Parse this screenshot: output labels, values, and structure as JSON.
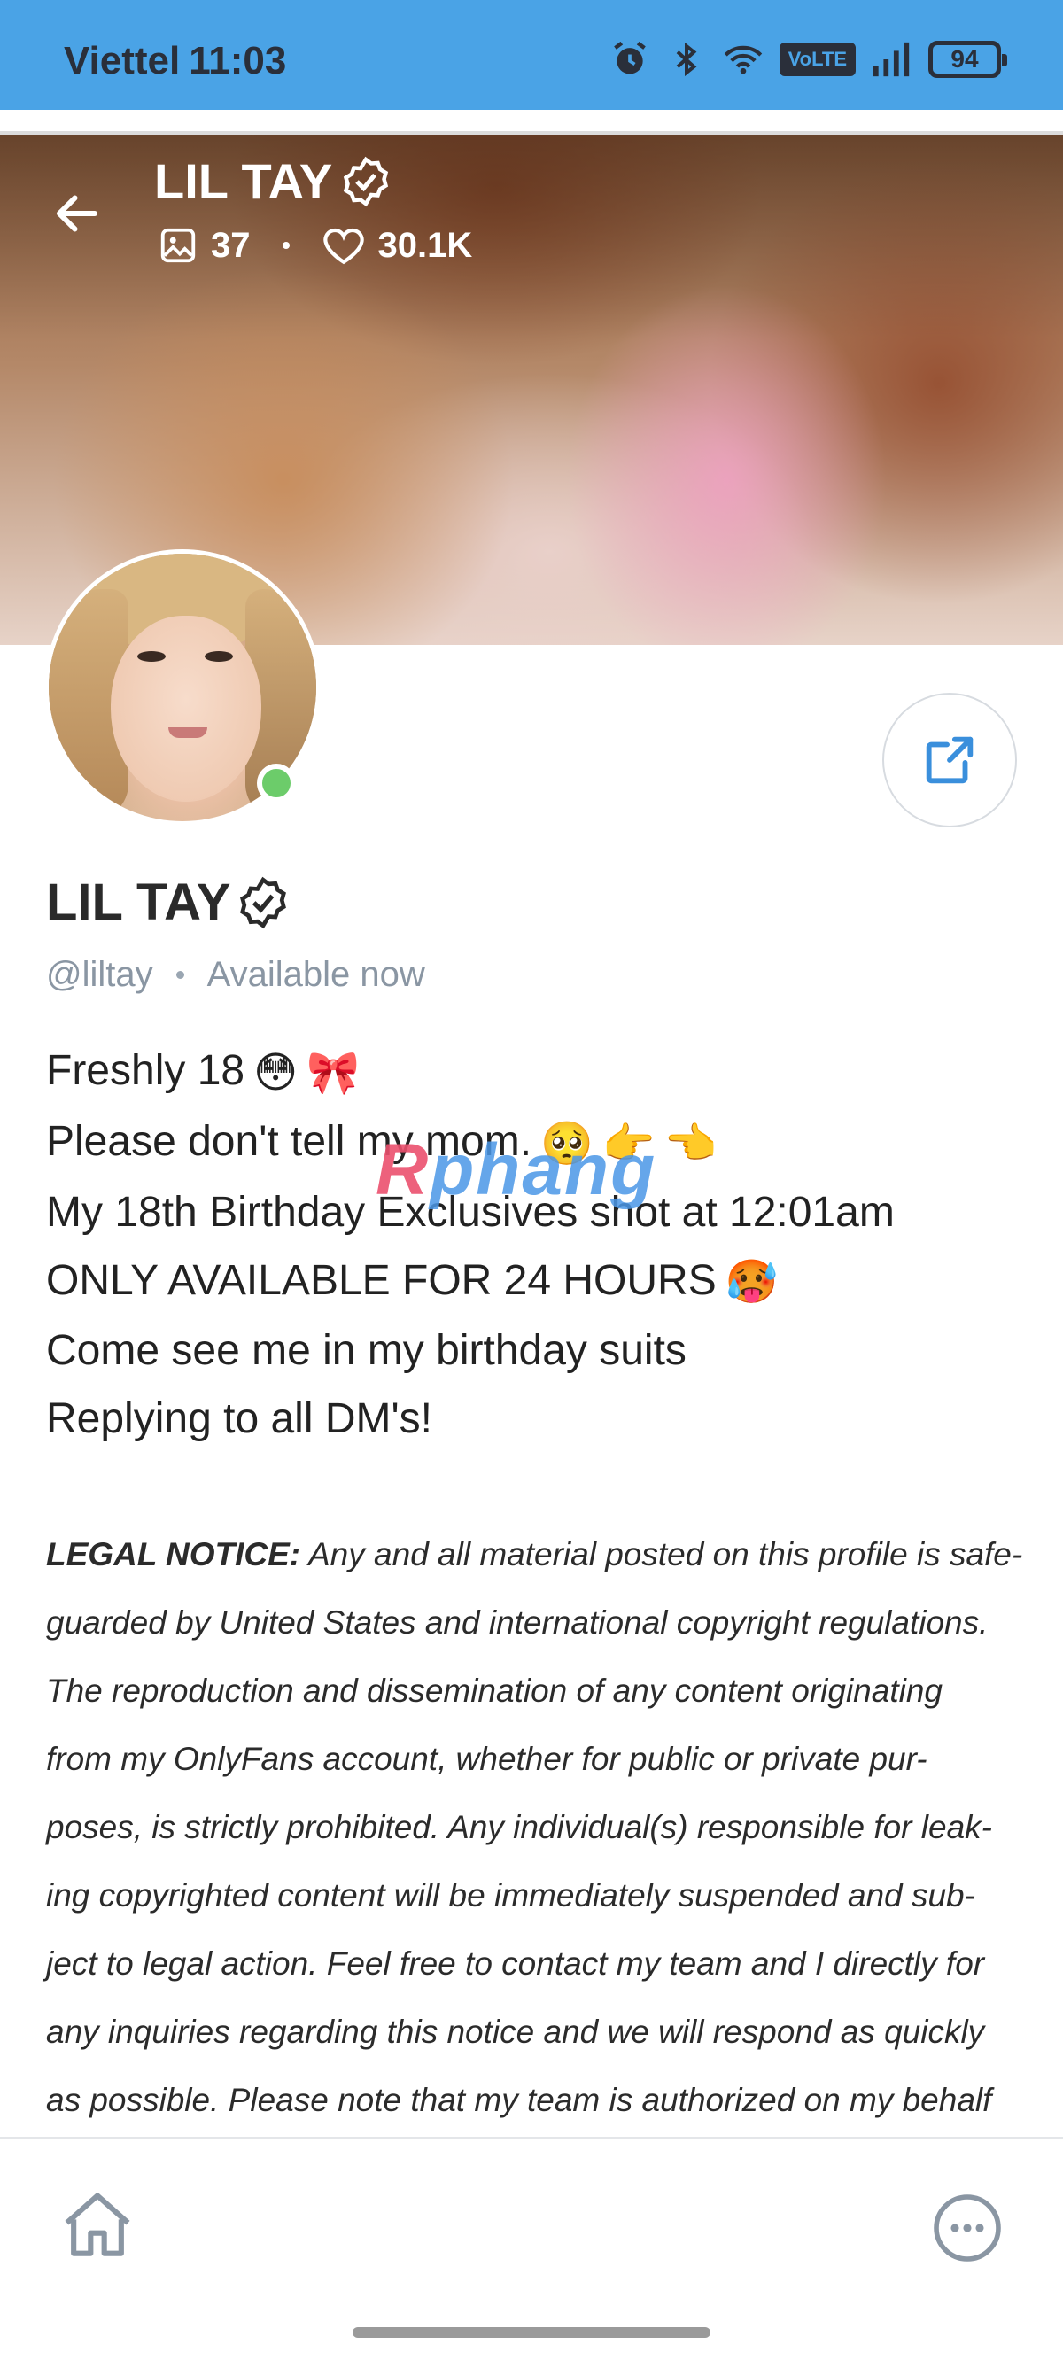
{
  "status_bar": {
    "carrier": "Viettel",
    "time": "11:03",
    "volte_label": "VoLTE",
    "battery": "94",
    "icons": [
      "alarm-icon",
      "bluetooth-icon",
      "wifi-icon",
      "volte-icon",
      "signal-icon",
      "battery-icon"
    ]
  },
  "cover": {
    "title": "LIL TAY",
    "media_count": "37",
    "likes_count": "30.1K"
  },
  "profile": {
    "name": "LIL TAY",
    "handle": "@liltay",
    "availability": "Available now",
    "online": true
  },
  "bio": {
    "lines": [
      "Freshly 18",
      "Please don't tell my mom.",
      "My 18th Birthday Exclusives shot at 12:01am",
      "ONLY AVAILABLE FOR 24 HOURS",
      "Come see me in my birthday suits",
      "Replying to all DM's!"
    ],
    "emoji": [
      "😳",
      "🎀",
      "🥺",
      "👉",
      "👈",
      "🥵"
    ]
  },
  "watermark": {
    "r": "R",
    "rest": "phang"
  },
  "legal": {
    "heading": "LEGAL NOTICE:",
    "lines": [
      " Any and all material posted on this profile is safe-",
      "guarded by United States and international copyright regulations.",
      "The reproduction and dissemination of any content originating",
      "from my OnlyFans account, whether for public or private pur-",
      "poses, is strictly prohibited. Any individual(s) responsible for leak-",
      "ing copyrighted content will be immediately suspended and sub-",
      "ject to legal action. Feel free to contact my team and I directly for",
      "any inquiries regarding this notice and we will respond as quickly",
      "as possible. Please note that my team is authorized on my behalf"
    ]
  },
  "colors": {
    "status_bar": "#4aa3e6",
    "accent": "#3a8fdc",
    "online": "#6ccc6a",
    "muted_text": "#8a96a3"
  }
}
